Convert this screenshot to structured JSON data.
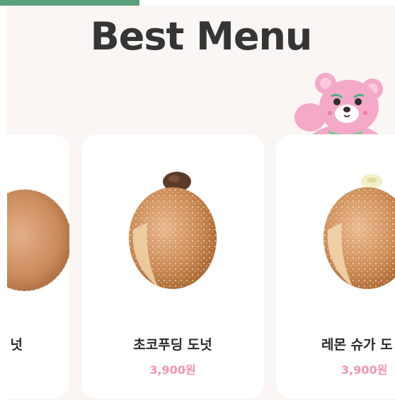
{
  "header": {
    "title": "Best Menu"
  },
  "products": [
    {
      "name": "넛",
      "price": ""
    },
    {
      "name": "초코푸딩 도넛",
      "price": "3,900원"
    },
    {
      "name": "레몬 슈가 도",
      "price": "3,900원"
    }
  ],
  "colors": {
    "top_strip": "#5aa07a",
    "background": "#f9f6f3",
    "card": "#ffffff",
    "title": "#353535",
    "price": "#f294b3",
    "mascot_pink": "#f4a9c8"
  },
  "icons": {
    "mascot": "pink-bear-mascot-icon",
    "donut": "sugar-donut-icon"
  }
}
